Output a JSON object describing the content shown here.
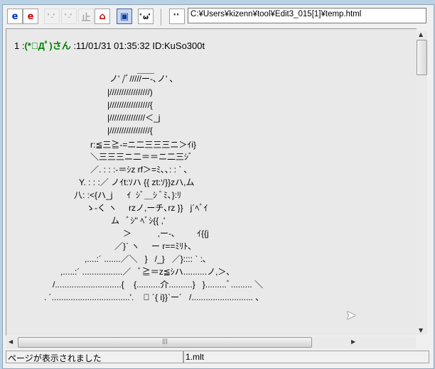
{
  "toolbar": {
    "buttons": [
      {
        "icon": "ie-blue-icon",
        "label": "e"
      },
      {
        "icon": "ie-red-icon",
        "label": "e"
      },
      {
        "icon": "cat-back-icon",
        "label": "ﾟ-ﾟ"
      },
      {
        "icon": "cat-forward-icon",
        "label": "ﾟ-ﾟ"
      },
      {
        "icon": "stop-icon",
        "label": "止"
      },
      {
        "icon": "home-icon",
        "label": "⌂"
      },
      {
        "icon": "windows-icon",
        "label": "▣"
      },
      {
        "icon": "cat-face-icon",
        "label": "ﾟωﾟ"
      },
      {
        "icon": "cat-face-small-icon",
        "label": "ﾟﾟ"
      }
    ],
    "address": "C:¥Users¥kizenn¥tool¥Edit3_015[1]¥temp.html"
  },
  "post": {
    "number": "1",
    "sep": " :",
    "name": "(*ﾟДﾟ)さん",
    "meta": " :11/01/31 01:35:32 ID:KuSo300t"
  },
  "aa": [
    "＿＿",
    "ノ' /ﾞ/////ー‐､ノ' ､",
    "|/////////////////)",
    "|/////////////////{",
    "|///////////////＜_j",
    "|/////////////////{",
    "r:≦三≧-=ニ二三三三ニ＞ｲi}",
    "＼三三三ニ二＝＝ニ二三ｼﾞ",
    "／. : : :-＝ｼz rf＞=ﾐ､､: : ` ､",
    "Y. : : :／ ノｲt:ｿハ {{ zt:ｿ}}zハ,ム",
    "八: :<{ハ_j      ｲ  ｼﾞ＿ｼ ﾞﾐ､}:ﾘ",
    "ゝ-く ヽ     rzノ,ーチ､rz }}   j´ﾍﾞｲ",
    "ム   ﾞｼ'' ﾍﾞｼ{{ ,'",
    "＞           ,ー‐､         ｲ{{j",
    "／}` ヽ     ー r==ﾐﾘﾄ､",
    ",....:´ .......／＼   }   /_}   ／}:::: ` :､",
    ",.....:´ .................／   ﾞ≧＝z≦ｼハ..........ノ,＞､",
    "/............................{    {..........介..........}   }.........ﾞ......... ＼",
    ". ´.................................'.    ﾞ ´{ i}}`ー´   /.......................... ､"
  ],
  "status": {
    "message": "ページが表示されました",
    "file": "1.mlt"
  }
}
